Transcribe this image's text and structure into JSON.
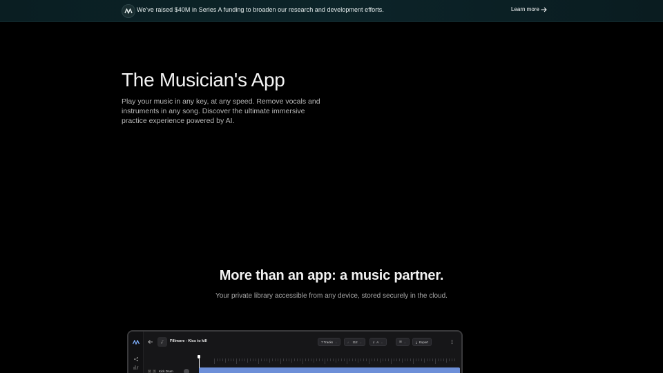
{
  "banner": {
    "text": "We've raised $40M in Series A funding to broaden our research and development efforts.",
    "link_label": "Learn more"
  },
  "hero": {
    "title": "The Musician's App",
    "subtitle": "Play your music in any key, at any speed. Remove vocals and instruments in any song. Discover the ultimate immersive practice experience powered by AI."
  },
  "section": {
    "title": "More than an app: a music partner.",
    "subtitle": "Your private library accessible from any device, stored securely in the cloud."
  },
  "app_preview": {
    "song_title": "Fillmore - Kiss to kill",
    "tracks_pill": "7 Tracks",
    "tempo_pill": "112",
    "key_pill": "A",
    "export_label": "Export",
    "track_name": "Kick Drum"
  },
  "colors": {
    "banner_bg": "#0c2429",
    "page_bg": "#000000",
    "waveform": "#6d8fd8"
  }
}
